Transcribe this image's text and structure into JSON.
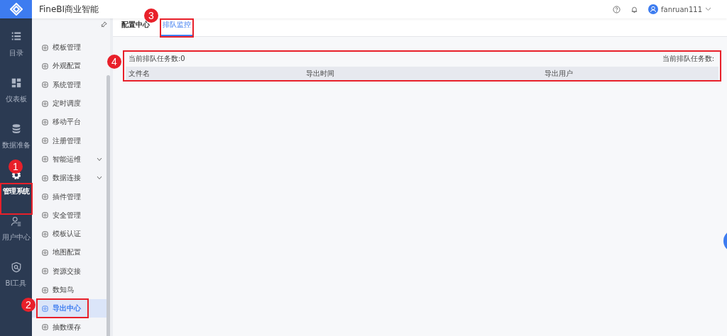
{
  "header": {
    "title": "FineBI商业智能",
    "user": "fanruan111"
  },
  "rail": [
    {
      "label": "目录",
      "selected": false
    },
    {
      "label": "仪表板",
      "selected": false
    },
    {
      "label": "数据准备",
      "selected": false
    },
    {
      "label": "管理系统",
      "selected": true
    },
    {
      "label": "用户中心",
      "selected": false
    },
    {
      "label": "BI工具",
      "selected": false
    }
  ],
  "menu": [
    {
      "label": "模板管理",
      "selected": false
    },
    {
      "label": "外观配置",
      "selected": false
    },
    {
      "label": "系统管理",
      "selected": false
    },
    {
      "label": "定时调度",
      "selected": false
    },
    {
      "label": "移动平台",
      "selected": false
    },
    {
      "label": "注册管理",
      "selected": false
    },
    {
      "label": "智能运维",
      "selected": false,
      "expanded": false
    },
    {
      "label": "数据连接",
      "selected": false,
      "expanded": false
    },
    {
      "label": "插件管理",
      "selected": false
    },
    {
      "label": "安全管理",
      "selected": false
    },
    {
      "label": "模板认证",
      "selected": false
    },
    {
      "label": "地图配置",
      "selected": false
    },
    {
      "label": "资源交接",
      "selected": false
    },
    {
      "label": "数知鸟",
      "selected": false
    },
    {
      "label": "导出中心",
      "selected": true
    },
    {
      "label": "抽数缓存",
      "selected": false
    }
  ],
  "tabs": [
    {
      "label": "配置中心",
      "selected": false
    },
    {
      "label": "排队监控",
      "selected": true
    }
  ],
  "queue": {
    "count_left": "当前排队任务数:0",
    "count_right": "当前排队任务数:"
  },
  "table": {
    "columns": [
      "文件名",
      "导出时间",
      "导出用户"
    ]
  },
  "callouts": [
    "1",
    "2",
    "3",
    "4"
  ]
}
